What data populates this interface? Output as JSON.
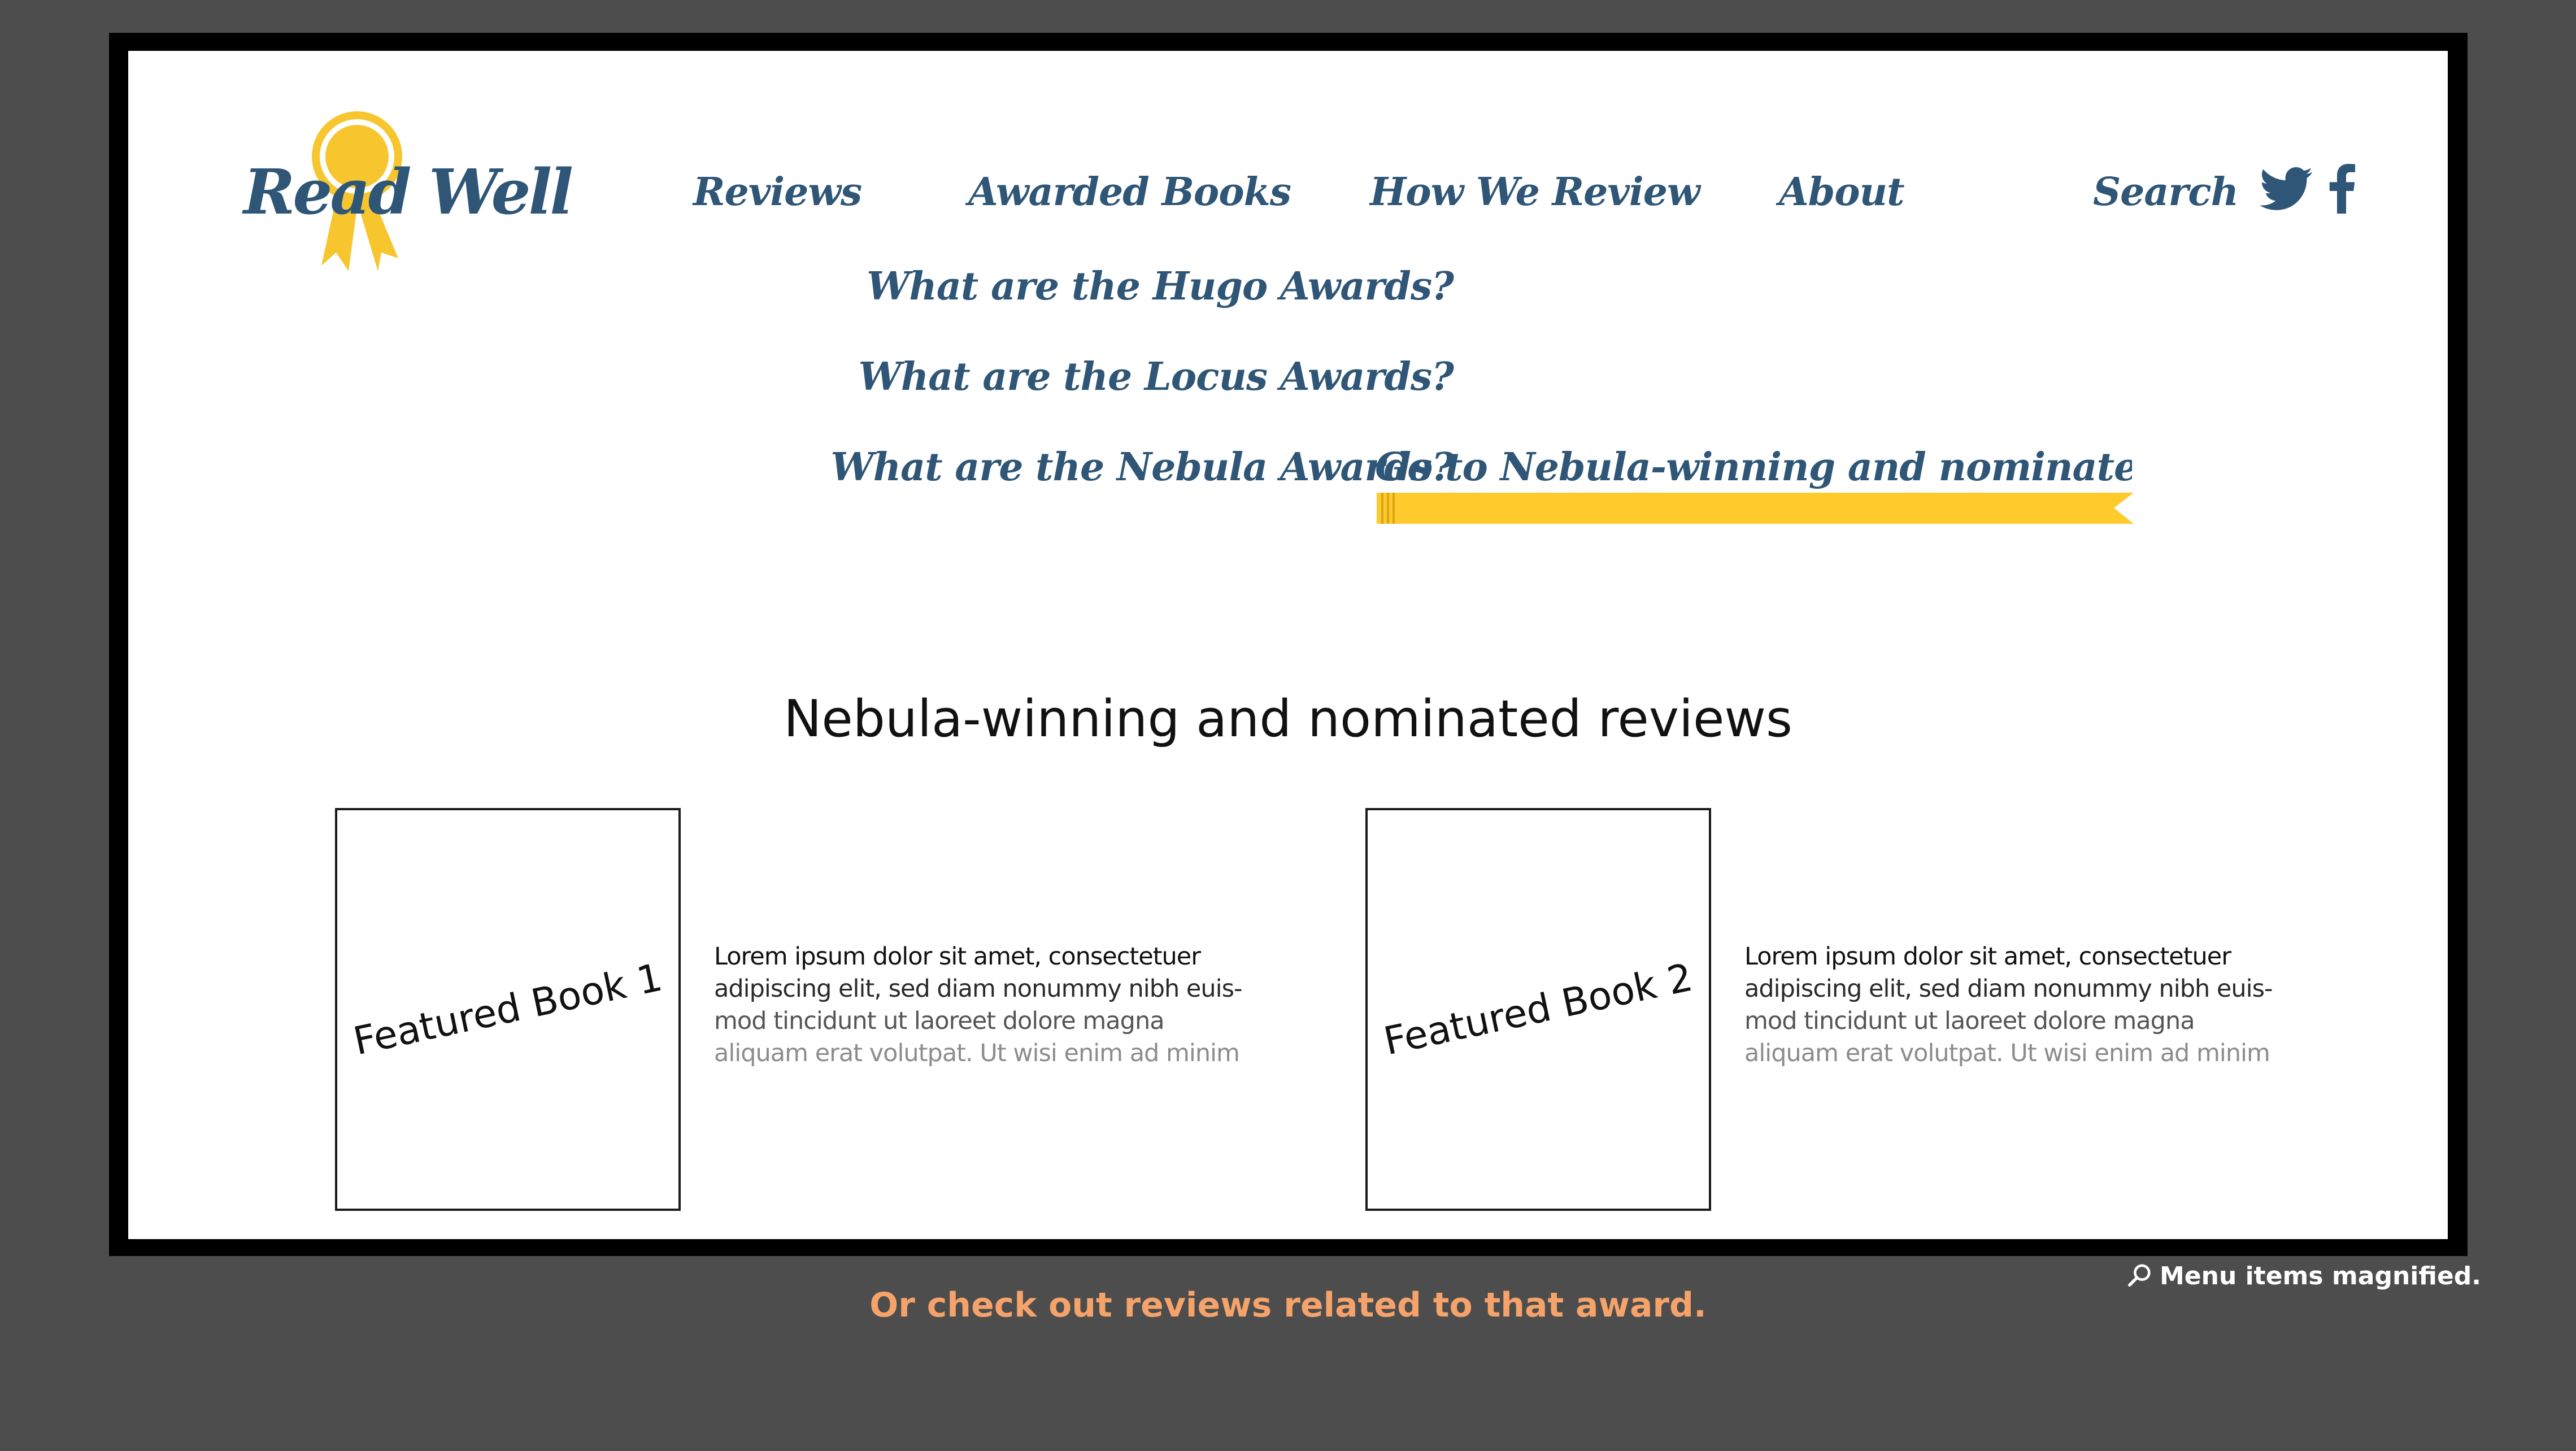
{
  "logo": {
    "text": "Read Well",
    "badge_color": "#f7c62f"
  },
  "nav": {
    "items": [
      "Reviews",
      "Awarded Books",
      "How We Review",
      "About",
      "Search"
    ],
    "social": [
      "twitter-icon",
      "facebook-icon"
    ]
  },
  "submenu": {
    "items": [
      "What are the Hugo Awards?",
      "What are the Locus Awards?",
      "What are the Nebula Awards?"
    ],
    "highlight": "Go to Nebula-winning and nominated reviews",
    "ribbon_color": "#ffca2c"
  },
  "main": {
    "heading": "Nebula-winning and nominated reviews",
    "books": [
      {
        "label": "Featured Book 1",
        "lines": [
          "Lorem ipsum dolor sit amet, consectetuer",
          "adipiscing elit, sed diam nonummy nibh euis-",
          "mod tincidunt ut laoreet dolore magna",
          "aliquam erat volutpat. Ut wisi enim ad minim"
        ]
      },
      {
        "label": "Featured Book 2",
        "lines": [
          "Lorem ipsum dolor sit amet, consectetuer",
          "adipiscing elit, sed diam nonummy nibh euis-",
          "mod tincidunt ut laoreet dolore magna",
          "aliquam erat volutpat. Ut wisi enim ad minim"
        ]
      }
    ]
  },
  "annotations": {
    "caption": "Or check out reviews related to that award.",
    "caption_color": "#f5a36b",
    "note": "Menu items magnified."
  },
  "colors": {
    "nav_text": "#2f5676",
    "backdrop": "#4d4d4d"
  }
}
